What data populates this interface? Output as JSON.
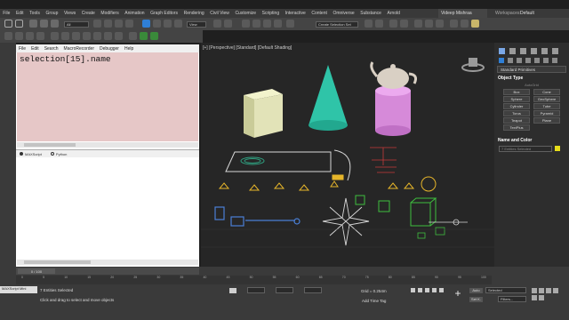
{
  "menu": [
    "File",
    "Edit",
    "Tools",
    "Group",
    "Views",
    "Create",
    "Modifiers",
    "Animation",
    "Graph Editors",
    "Rendering",
    "Civil View",
    "Customize",
    "Scripting",
    "Interactive",
    "Content",
    "Omniverse",
    "Substance",
    "Arnold"
  ],
  "user": "Videep Mishraa",
  "workspace": {
    "label": "Workspaces:",
    "value": "Default"
  },
  "toolbar": {
    "filter": "All",
    "view": "View",
    "selection_set": "Create Selection Set"
  },
  "listener": {
    "menus": [
      "File",
      "Edit",
      "Search",
      "MacroRecorder",
      "Debugger",
      "Help"
    ],
    "macro_text": "selection[15].name",
    "tabs": [
      "MAXScript",
      "Python"
    ]
  },
  "viewport": {
    "label": "[+] [Perspective] [Standard] [Default Shading]"
  },
  "command_panel": {
    "category": "Standard Primitives",
    "object_type_title": "Object Type",
    "autogrid": "AutoGrid",
    "buttons": [
      [
        "Box",
        "Cone"
      ],
      [
        "Sphere",
        "GeoSphere"
      ],
      [
        "Cylinder",
        "Tube"
      ],
      [
        "Torus",
        "Pyramid"
      ],
      [
        "Teapot",
        "Plane"
      ],
      [
        "TextPlus",
        ""
      ]
    ],
    "name_color_title": "Name and Color",
    "name_field": "7 Entities Selected"
  },
  "timeline": {
    "frame": "0 / 100",
    "ticks": [
      "0",
      "5",
      "10",
      "15",
      "20",
      "25",
      "30",
      "35",
      "40",
      "45",
      "50",
      "55",
      "60",
      "65",
      "70",
      "75",
      "80",
      "85",
      "90",
      "95",
      "100"
    ]
  },
  "status": {
    "maxscript_mini": "MAXScript Mini",
    "selected": "7 Entities Selected",
    "prompt": "Click and drag to select and move objects",
    "grid": "Grid = 0.254m",
    "add_time_tag": "Add Time Tag",
    "auto": "Auto",
    "selected_dd": "Selected",
    "set_k": "Set K.",
    "filters": "Filters..."
  },
  "colors": {
    "accent": "#2f7fd6",
    "macro_bg": "#e6c7c7",
    "teapot_pink": "#d68ad9",
    "cone": "#2fc4a8",
    "box": "#e2e3b8"
  }
}
